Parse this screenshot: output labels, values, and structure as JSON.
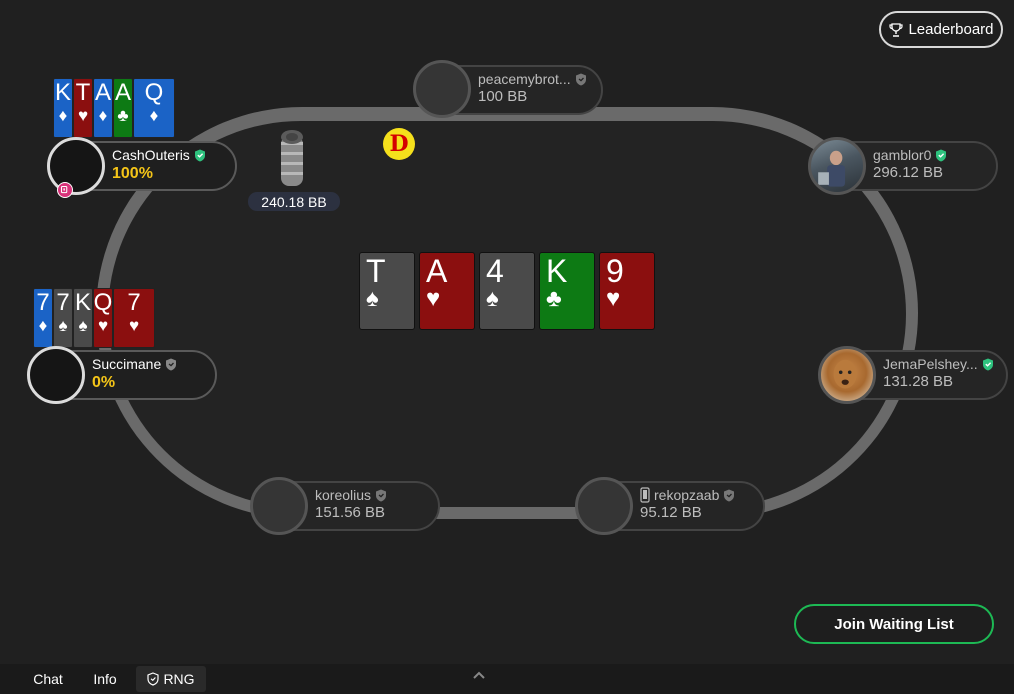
{
  "header": {
    "leaderboard_label": "Leaderboard"
  },
  "pot": {
    "amount": "240.18 BB"
  },
  "dealer": {
    "label": "D"
  },
  "board": [
    {
      "rank": "T",
      "suit": "♠",
      "color": "spade"
    },
    {
      "rank": "A",
      "suit": "♥",
      "color": "heart"
    },
    {
      "rank": "4",
      "suit": "♠",
      "color": "spade"
    },
    {
      "rank": "K",
      "suit": "♣",
      "color": "club"
    },
    {
      "rank": "9",
      "suit": "♥",
      "color": "heart"
    }
  ],
  "players": {
    "top": {
      "name": "peacemybrot...",
      "stack": "100 BB",
      "verified": false
    },
    "cash": {
      "name": "CashOuteris",
      "equity": "100%",
      "verified": true,
      "cards": [
        {
          "rank": "K",
          "suit": "♦"
        },
        {
          "rank": "T",
          "suit": "♥"
        },
        {
          "rank": "A",
          "suit": "♦"
        },
        {
          "rank": "A",
          "suit": "♣"
        },
        {
          "rank": "Q",
          "suit": "♦"
        }
      ]
    },
    "succi": {
      "name": "Succimane",
      "equity": "0%",
      "verified": false,
      "cards": [
        {
          "rank": "7",
          "suit": "♦"
        },
        {
          "rank": "7",
          "suit": "♠"
        },
        {
          "rank": "K",
          "suit": "♠"
        },
        {
          "rank": "Q",
          "suit": "♥"
        },
        {
          "rank": "7",
          "suit": "♥"
        }
      ]
    },
    "gamblor": {
      "name": "gamblor0",
      "stack": "296.12 BB",
      "verified": true
    },
    "jema": {
      "name": "JemaPelshey...",
      "stack": "131.28 BB",
      "verified": true
    },
    "koreo": {
      "name": "koreolius",
      "stack": "151.56 BB",
      "verified": false
    },
    "rekop": {
      "name": "rekopzaab",
      "stack": "95.12 BB",
      "verified": false
    }
  },
  "actions": {
    "join_label": "Join Waiting List"
  },
  "footer": {
    "chat_label": "Chat",
    "info_label": "Info",
    "rng_label": "RNG"
  },
  "colors": {
    "spade": "#4a4a4a",
    "heart": "#8b0f0f",
    "club": "#0d7a14",
    "diamond": "#1b63c6",
    "accent_green": "#1db954",
    "equity_gold": "#f5c518"
  }
}
